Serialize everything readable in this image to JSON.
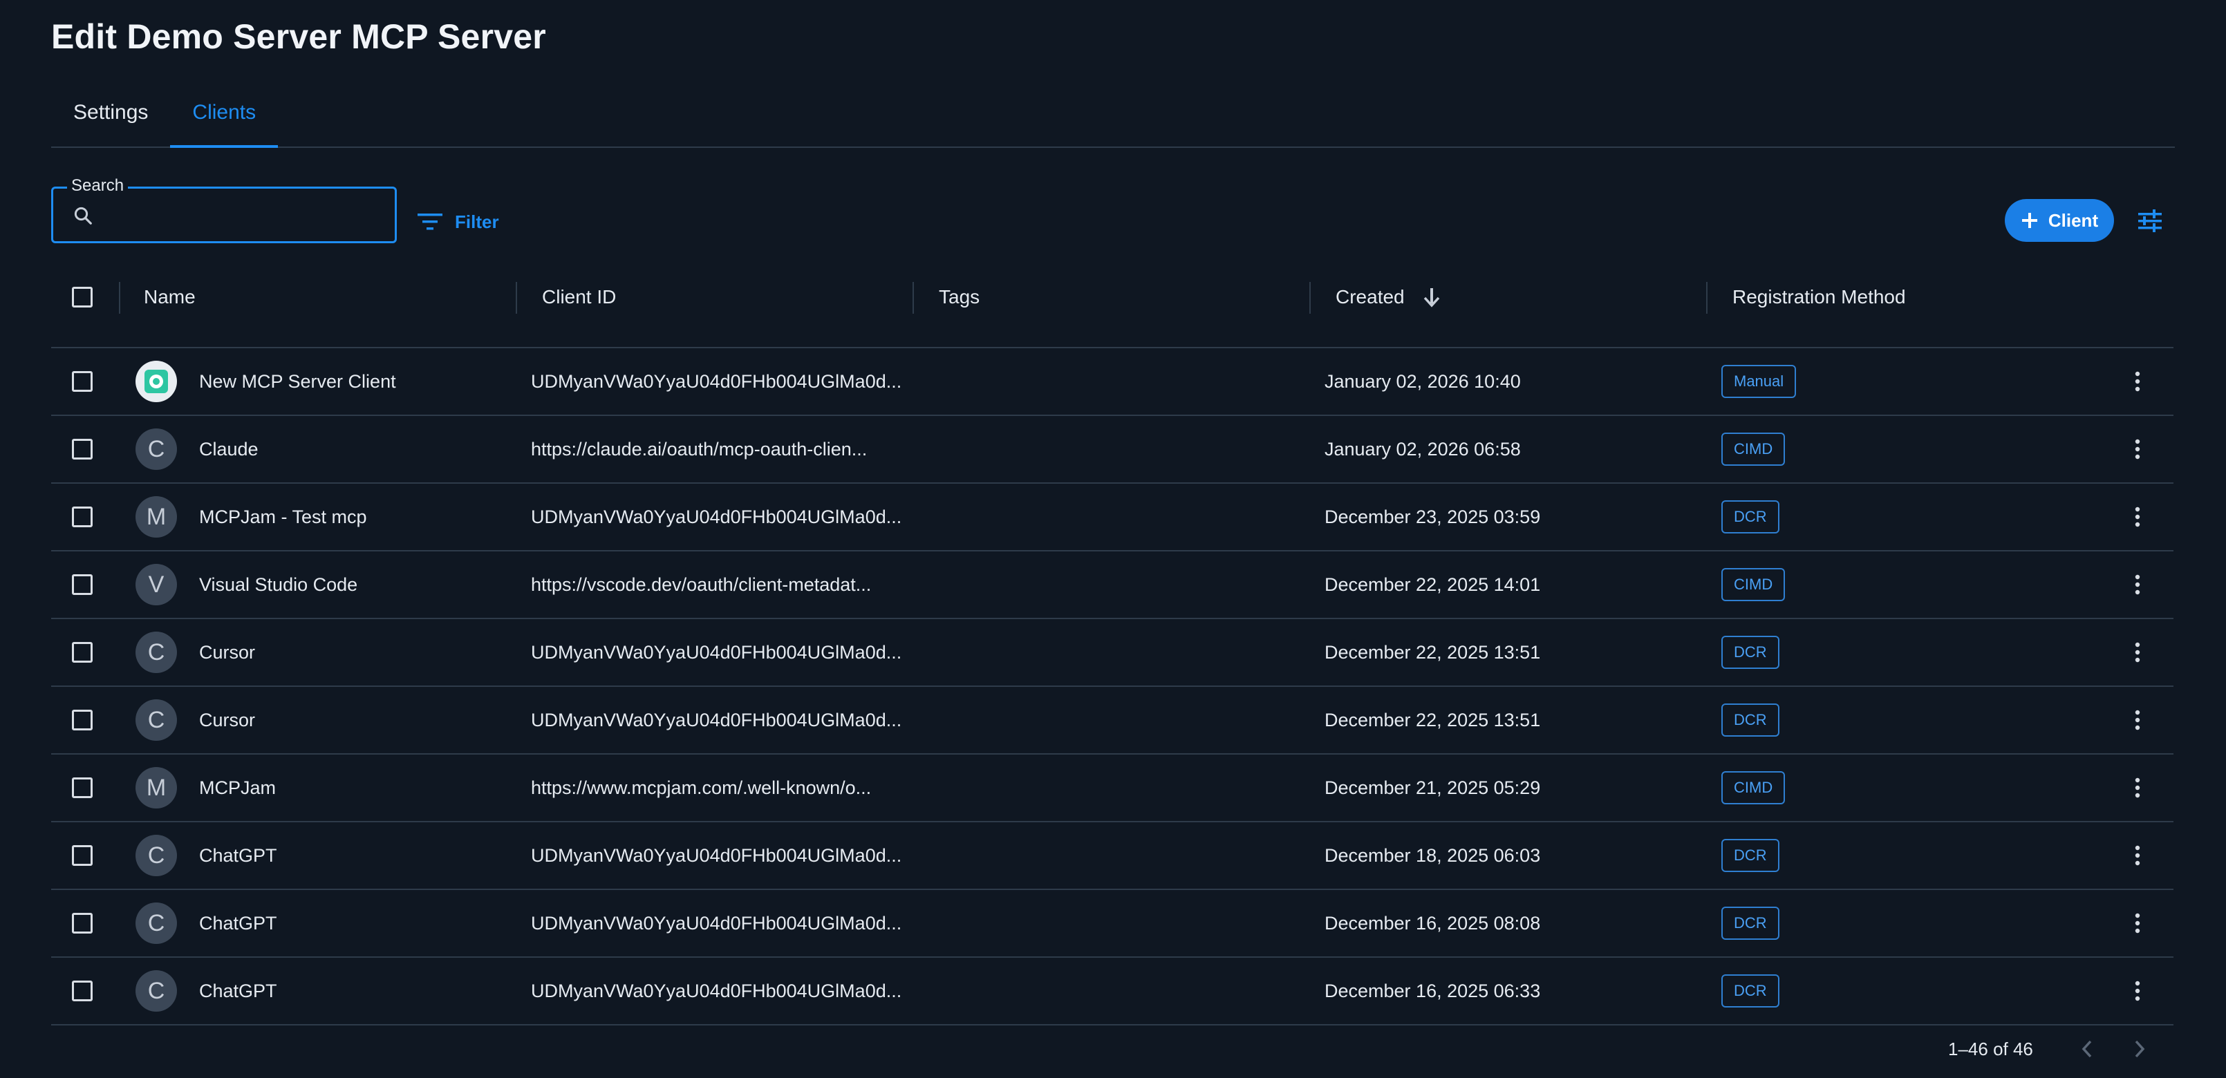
{
  "page": {
    "title": "Edit Demo Server MCP Server"
  },
  "tabs": [
    {
      "label": "Settings",
      "active": false
    },
    {
      "label": "Clients",
      "active": true
    }
  ],
  "toolbar": {
    "search_label": "Search",
    "search_value": "",
    "filter_label": "Filter",
    "add_client_label": "Client"
  },
  "table": {
    "columns": {
      "name": "Name",
      "client_id": "Client ID",
      "tags": "Tags",
      "created": "Created",
      "registration_method": "Registration Method"
    },
    "sort": {
      "column": "created",
      "direction": "desc"
    },
    "rows": [
      {
        "avatar": "logo",
        "name": "New MCP Server Client",
        "client_id": "UDMyanVWa0YyaU04d0FHb004UGlMa0d...",
        "tags": "",
        "created": "January 02, 2026 10:40",
        "method": "Manual"
      },
      {
        "avatar": "C",
        "name": "Claude",
        "client_id": "https://claude.ai/oauth/mcp-oauth-clien...",
        "tags": "",
        "created": "January 02, 2026 06:58",
        "method": "CIMD"
      },
      {
        "avatar": "M",
        "name": "MCPJam - Test mcp",
        "client_id": "UDMyanVWa0YyaU04d0FHb004UGlMa0d...",
        "tags": "",
        "created": "December 23, 2025 03:59",
        "method": "DCR"
      },
      {
        "avatar": "V",
        "name": "Visual Studio Code",
        "client_id": "https://vscode.dev/oauth/client-metadat...",
        "tags": "",
        "created": "December 22, 2025 14:01",
        "method": "CIMD"
      },
      {
        "avatar": "C",
        "name": "Cursor",
        "client_id": "UDMyanVWa0YyaU04d0FHb004UGlMa0d...",
        "tags": "",
        "created": "December 22, 2025 13:51",
        "method": "DCR"
      },
      {
        "avatar": "C",
        "name": "Cursor",
        "client_id": "UDMyanVWa0YyaU04d0FHb004UGlMa0d...",
        "tags": "",
        "created": "December 22, 2025 13:51",
        "method": "DCR"
      },
      {
        "avatar": "M",
        "name": "MCPJam",
        "client_id": "https://www.mcpjam.com/.well-known/o...",
        "tags": "",
        "created": "December 21, 2025 05:29",
        "method": "CIMD"
      },
      {
        "avatar": "C",
        "name": "ChatGPT",
        "client_id": "UDMyanVWa0YyaU04d0FHb004UGlMa0d...",
        "tags": "",
        "created": "December 18, 2025 06:03",
        "method": "DCR"
      },
      {
        "avatar": "C",
        "name": "ChatGPT",
        "client_id": "UDMyanVWa0YyaU04d0FHb004UGlMa0d...",
        "tags": "",
        "created": "December 16, 2025 08:08",
        "method": "DCR"
      },
      {
        "avatar": "C",
        "name": "ChatGPT",
        "client_id": "UDMyanVWa0YyaU04d0FHb004UGlMa0d...",
        "tags": "",
        "created": "December 16, 2025 06:33",
        "method": "DCR"
      }
    ]
  },
  "pagination": {
    "range_label": "1–46 of 46"
  },
  "icons": {
    "search": "search-icon",
    "filter": "filter-icon",
    "add": "plus-icon",
    "columns": "tune-icon",
    "sort": "arrow-down-icon",
    "more": "more-vertical-icon",
    "prev": "chevron-left-icon",
    "next": "chevron-right-icon"
  },
  "colors": {
    "background": "#0f1722",
    "accent": "#1e8df2",
    "divider": "#2e3b4a",
    "text": "#e6ebf1"
  }
}
